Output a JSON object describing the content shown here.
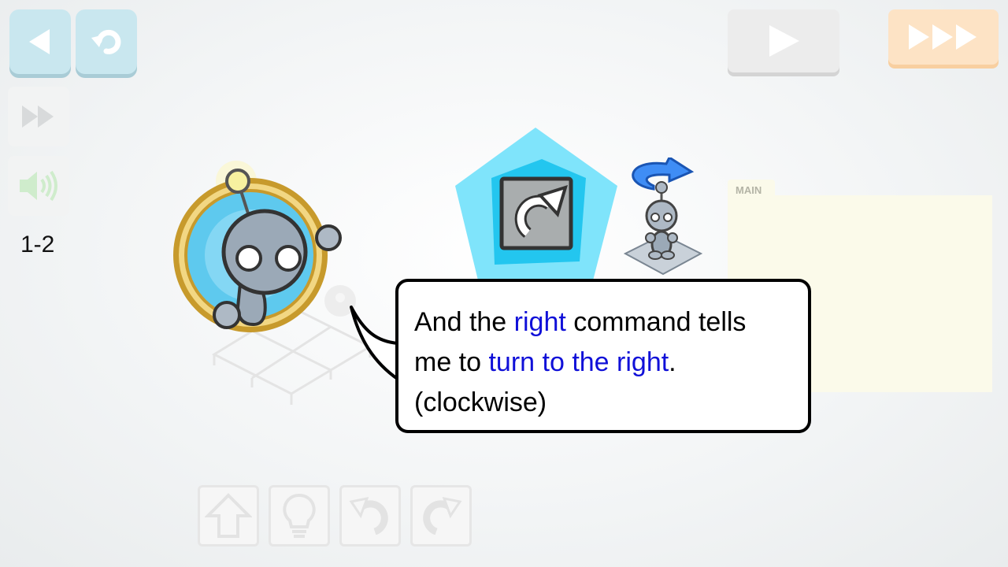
{
  "toolbar": {
    "back_icon": "triangle-left-icon",
    "reset_icon": "undo-arrow-icon",
    "play_icon": "play-icon",
    "fast_forward_icon": "triple-play-icon"
  },
  "sidebar": {
    "speed_icon": "fast-forward-icon",
    "sound_icon": "speaker-icon",
    "level": "1-2"
  },
  "program": {
    "main_label": "MAIN"
  },
  "bubble": {
    "line1_a": "And the ",
    "line1_hl": "right",
    "line1_b": " command tells",
    "line2_a": "me to ",
    "line2_hl": "turn to the right",
    "line2_b": ".",
    "line3": "(clockwise)"
  },
  "commands": [
    "forward-arrow-icon",
    "lightbulb-icon",
    "turn-left-icon",
    "turn-right-icon"
  ],
  "colors": {
    "highlight_text": "#1010d8",
    "button_blue": "#c9e7ef",
    "button_orange": "#fde3c5",
    "pentagon": "#7fe4fb"
  }
}
